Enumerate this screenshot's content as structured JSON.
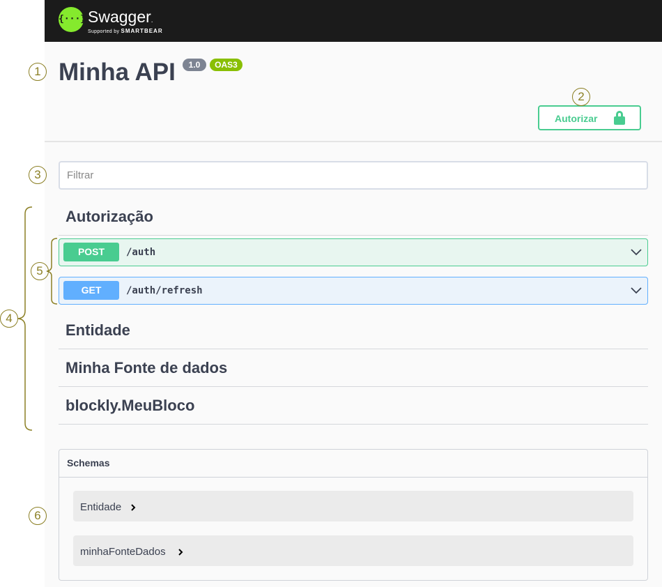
{
  "header": {
    "logo_glyph": "{···}",
    "logo_text": "Swagger",
    "logo_trademark": ".",
    "logo_sub_prefix": "Supported by",
    "logo_sub_brand": "SMARTBEAR"
  },
  "info": {
    "title": "Minha API",
    "version_badge": "1.0",
    "oas_badge": "OAS3"
  },
  "authorize_button": {
    "label": "Autorizar",
    "icon": "unlocked-padlock-icon"
  },
  "filter": {
    "placeholder": "Filtrar",
    "value": ""
  },
  "tags": [
    {
      "name": "Autorização",
      "operations": [
        {
          "method": "POST",
          "path": "/auth"
        },
        {
          "method": "GET",
          "path": "/auth/refresh"
        }
      ]
    },
    {
      "name": "Entidade"
    },
    {
      "name": "Minha Fonte de dados"
    },
    {
      "name": "blockly.MeuBloco"
    }
  ],
  "schemas": {
    "title": "Schemas",
    "models": [
      {
        "name": "Entidade"
      },
      {
        "name": "minhaFonteDados"
      }
    ]
  },
  "markers": [
    "1",
    "2",
    "3",
    "4",
    "5",
    "6"
  ],
  "colors": {
    "topbar": "#1b1b1b",
    "logo_green": "#85ea2d",
    "post": "#49cc90",
    "get": "#61affe",
    "version_badge": "#7d8492",
    "oas_badge": "#89bf04",
    "annotation": "#8b7f24"
  }
}
